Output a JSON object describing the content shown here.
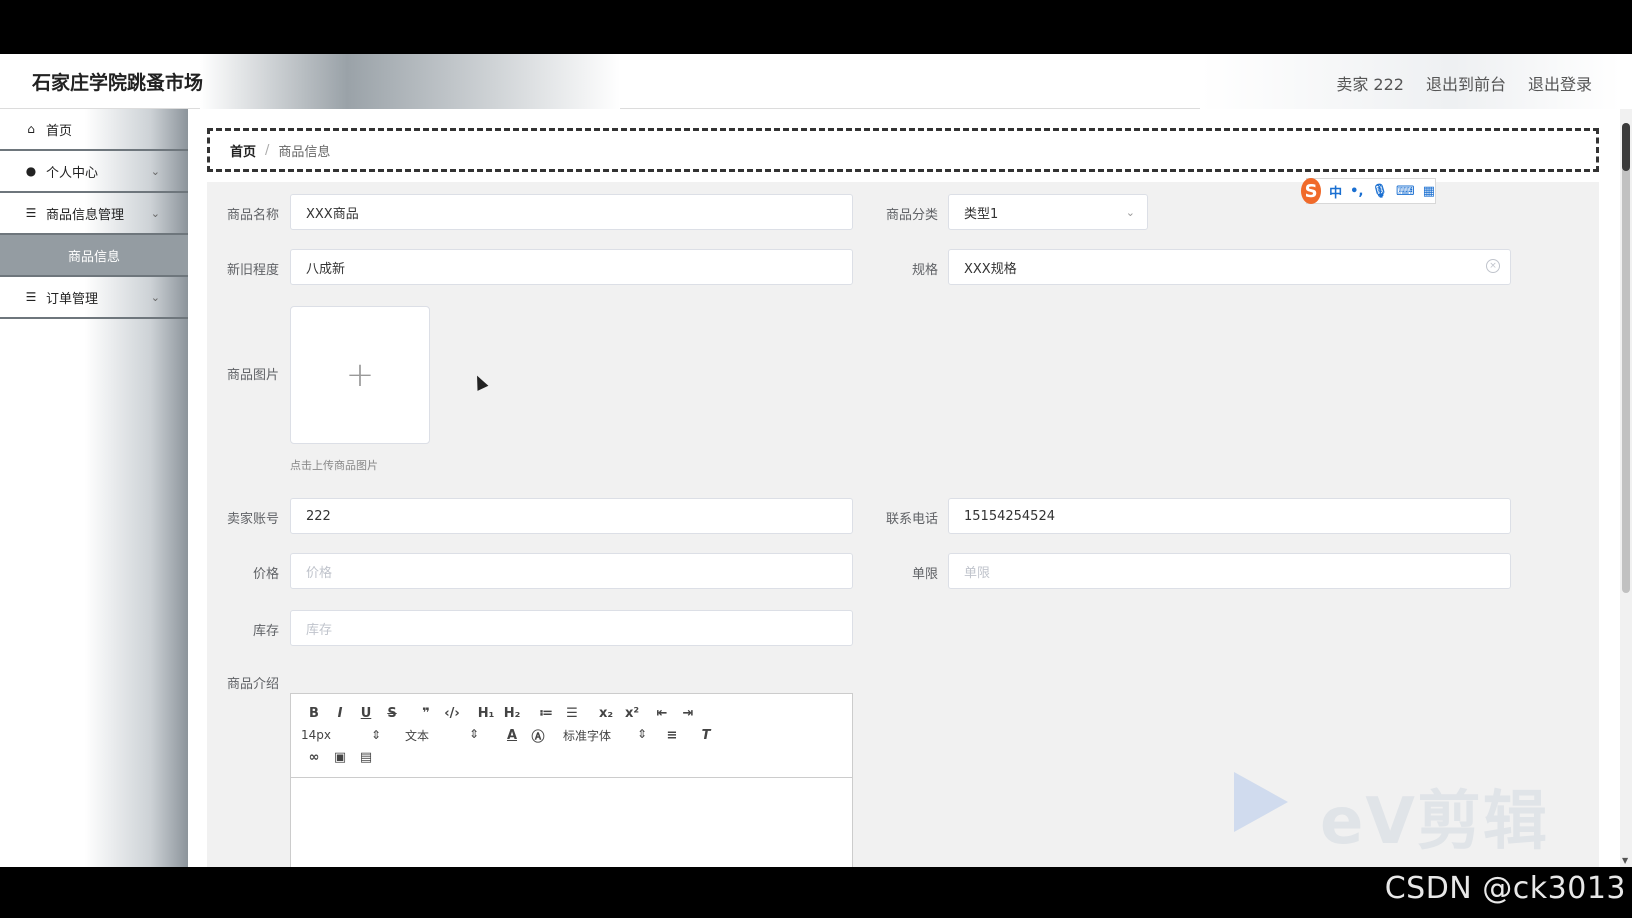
{
  "app": {
    "title": "石家庄学院跳蚤市场"
  },
  "header": {
    "user": "卖家 222",
    "back_front": "退出到前台",
    "logout": "退出登录"
  },
  "sidebar": {
    "items": [
      {
        "label": "首页",
        "icon": "home-icon"
      },
      {
        "label": "个人中心",
        "icon": "user-icon"
      },
      {
        "label": "商品信息管理",
        "icon": "list-icon"
      },
      {
        "label": "商品信息",
        "icon": ""
      },
      {
        "label": "订单管理",
        "icon": "list-icon"
      }
    ]
  },
  "breadcrumb": {
    "home": "首页",
    "separator": "/",
    "current": "商品信息"
  },
  "form": {
    "name": {
      "label": "商品名称",
      "value": "XXX商品"
    },
    "category": {
      "label": "商品分类",
      "value": "类型1"
    },
    "condition": {
      "label": "新旧程度",
      "value": "八成新"
    },
    "spec": {
      "label": "规格",
      "value": "XXX规格"
    },
    "image": {
      "label": "商品图片",
      "tip": "点击上传商品图片"
    },
    "seller": {
      "label": "卖家账号",
      "value": "222"
    },
    "phone": {
      "label": "联系电话",
      "value": "15154254524"
    },
    "price": {
      "label": "价格",
      "placeholder": "价格"
    },
    "limit": {
      "label": "单限",
      "placeholder": "单限"
    },
    "stock": {
      "label": "库存",
      "placeholder": "库存"
    },
    "intro": {
      "label": "商品介绍"
    }
  },
  "editor": {
    "font_size": "14px",
    "text_type": "文本",
    "font_family": "标准字体",
    "buttons_row1": [
      "B",
      "I",
      "U",
      "S",
      "❞",
      "‹/›",
      "H₁",
      "H₂",
      "≔",
      "☰",
      "x₂",
      "x²",
      "⇤",
      "⇥"
    ]
  },
  "ime": {
    "logo": "S",
    "lang": "中",
    "punct": "•,",
    "mic": "🎙",
    "kbd": "⌨",
    "apps": "▦"
  },
  "watermark": {
    "csdn": "CSDN @ck3013",
    "ev": "eV剪辑"
  }
}
